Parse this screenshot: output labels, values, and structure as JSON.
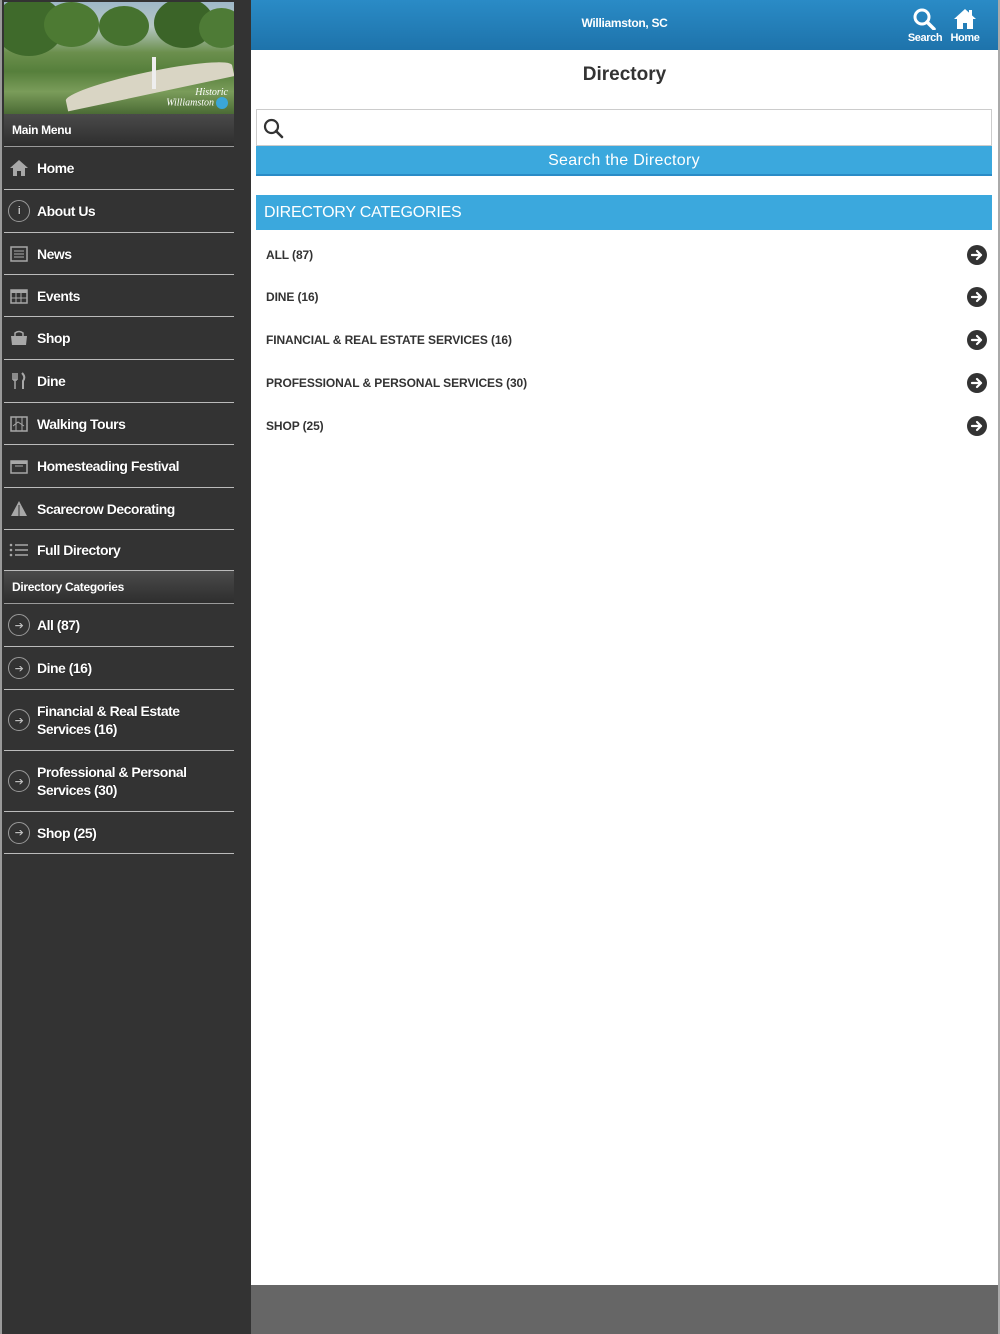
{
  "sidebar": {
    "hero": {
      "logo_line1": "Historic",
      "logo_line2": "Williamston"
    },
    "main_menu_header": "Main Menu",
    "main_menu": [
      {
        "label": "Home",
        "icon": "home-icon"
      },
      {
        "label": "About Us",
        "icon": "info-icon"
      },
      {
        "label": "News",
        "icon": "newspaper-icon"
      },
      {
        "label": "Events",
        "icon": "calendar-icon"
      },
      {
        "label": "Shop",
        "icon": "shopping-bag-icon"
      },
      {
        "label": "Dine",
        "icon": "fork-knife-icon"
      },
      {
        "label": "Walking Tours",
        "icon": "map-icon"
      },
      {
        "label": "Homesteading Festival",
        "icon": "festival-icon"
      },
      {
        "label": "Scarecrow Decorating",
        "icon": "scarecrow-icon"
      },
      {
        "label": "Full Directory",
        "icon": "list-icon"
      }
    ],
    "categories_header": "Directory Categories",
    "categories": [
      {
        "label": "All (87)"
      },
      {
        "label": "Dine (16)"
      },
      {
        "label": "Financial & Real Estate Services (16)"
      },
      {
        "label": "Professional & Personal Services (30)"
      },
      {
        "label": "Shop (25)"
      }
    ]
  },
  "header": {
    "title": "Williamston, SC",
    "search_label": "Search",
    "home_label": "Home"
  },
  "main": {
    "page_title": "Directory",
    "search": {
      "value": "",
      "placeholder": ""
    },
    "search_button_label": "Search the Directory",
    "categories_header": "DIRECTORY CATEGORIES",
    "categories": [
      {
        "label": "ALL (87)"
      },
      {
        "label": "DINE (16)"
      },
      {
        "label": "FINANCIAL & REAL ESTATE SERVICES (16)"
      },
      {
        "label": "PROFESSIONAL & PERSONAL SERVICES (30)"
      },
      {
        "label": "SHOP (25)"
      }
    ]
  },
  "colors": {
    "sidebar_bg": "#333333",
    "header_blue": "#1e73ab",
    "accent_blue": "#3ba8dd",
    "footer_gray": "#666666"
  }
}
